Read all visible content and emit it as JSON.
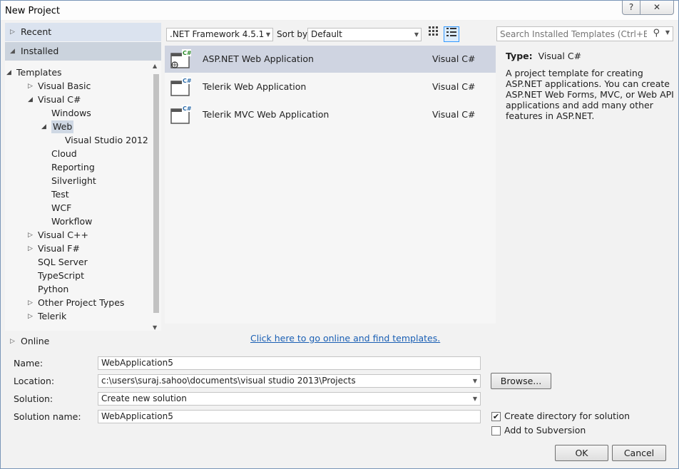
{
  "window": {
    "title": "New Project",
    "help_glyph": "?",
    "close_glyph": "✕"
  },
  "categories": {
    "recent": "Recent",
    "installed": "Installed",
    "online": "Online"
  },
  "tree": [
    {
      "label": "Templates",
      "arrow": "◢"
    },
    {
      "label": "Visual Basic",
      "arrow": "▷"
    },
    {
      "label": "Visual C#",
      "arrow": "◢"
    },
    {
      "label": "Windows",
      "arrow": ""
    },
    {
      "label": "Web",
      "arrow": "◢",
      "selected": true
    },
    {
      "label": "Visual Studio 2012",
      "arrow": ""
    },
    {
      "label": "Cloud",
      "arrow": ""
    },
    {
      "label": "Reporting",
      "arrow": ""
    },
    {
      "label": "Silverlight",
      "arrow": ""
    },
    {
      "label": "Test",
      "arrow": ""
    },
    {
      "label": "WCF",
      "arrow": ""
    },
    {
      "label": "Workflow",
      "arrow": ""
    },
    {
      "label": "Visual C++",
      "arrow": "▷"
    },
    {
      "label": "Visual F#",
      "arrow": "▷"
    },
    {
      "label": "SQL Server",
      "arrow": ""
    },
    {
      "label": "TypeScript",
      "arrow": ""
    },
    {
      "label": "Python",
      "arrow": ""
    },
    {
      "label": "Other Project Types",
      "arrow": "▷"
    },
    {
      "label": "Telerik",
      "arrow": "▷"
    }
  ],
  "toolbar": {
    "framework": ".NET Framework 4.5.1",
    "sort_label": "Sort by:",
    "sort_value": "Default"
  },
  "search": {
    "placeholder": "Search Installed Templates (Ctrl+E)"
  },
  "templates": [
    {
      "name": "ASP.NET Web Application",
      "lang": "Visual C#",
      "selected": true
    },
    {
      "name": "Telerik Web Application",
      "lang": "Visual C#"
    },
    {
      "name": "Telerik MVC Web Application",
      "lang": "Visual C#"
    }
  ],
  "details": {
    "type_label": "Type:",
    "type_value": "Visual C#",
    "description": "A project template for creating ASP.NET applications. You can create ASP.NET Web Forms, MVC,  or Web API applications and add many other features in ASP.NET."
  },
  "online_link": "Click here to go online and find templates.",
  "form": {
    "name_label": "Name:",
    "name_value": "WebApplication5",
    "location_label": "Location:",
    "location_value": "c:\\users\\suraj.sahoo\\documents\\visual studio 2013\\Projects",
    "solution_label": "Solution:",
    "solution_value": "Create new solution",
    "solution_name_label": "Solution name:",
    "solution_name_value": "WebApplication5",
    "browse": "Browse...",
    "create_dir_label": "Create directory for solution",
    "create_dir_checked": true,
    "subversion_label": "Add to Subversion",
    "subversion_checked": false,
    "ok": "OK",
    "cancel": "Cancel"
  }
}
